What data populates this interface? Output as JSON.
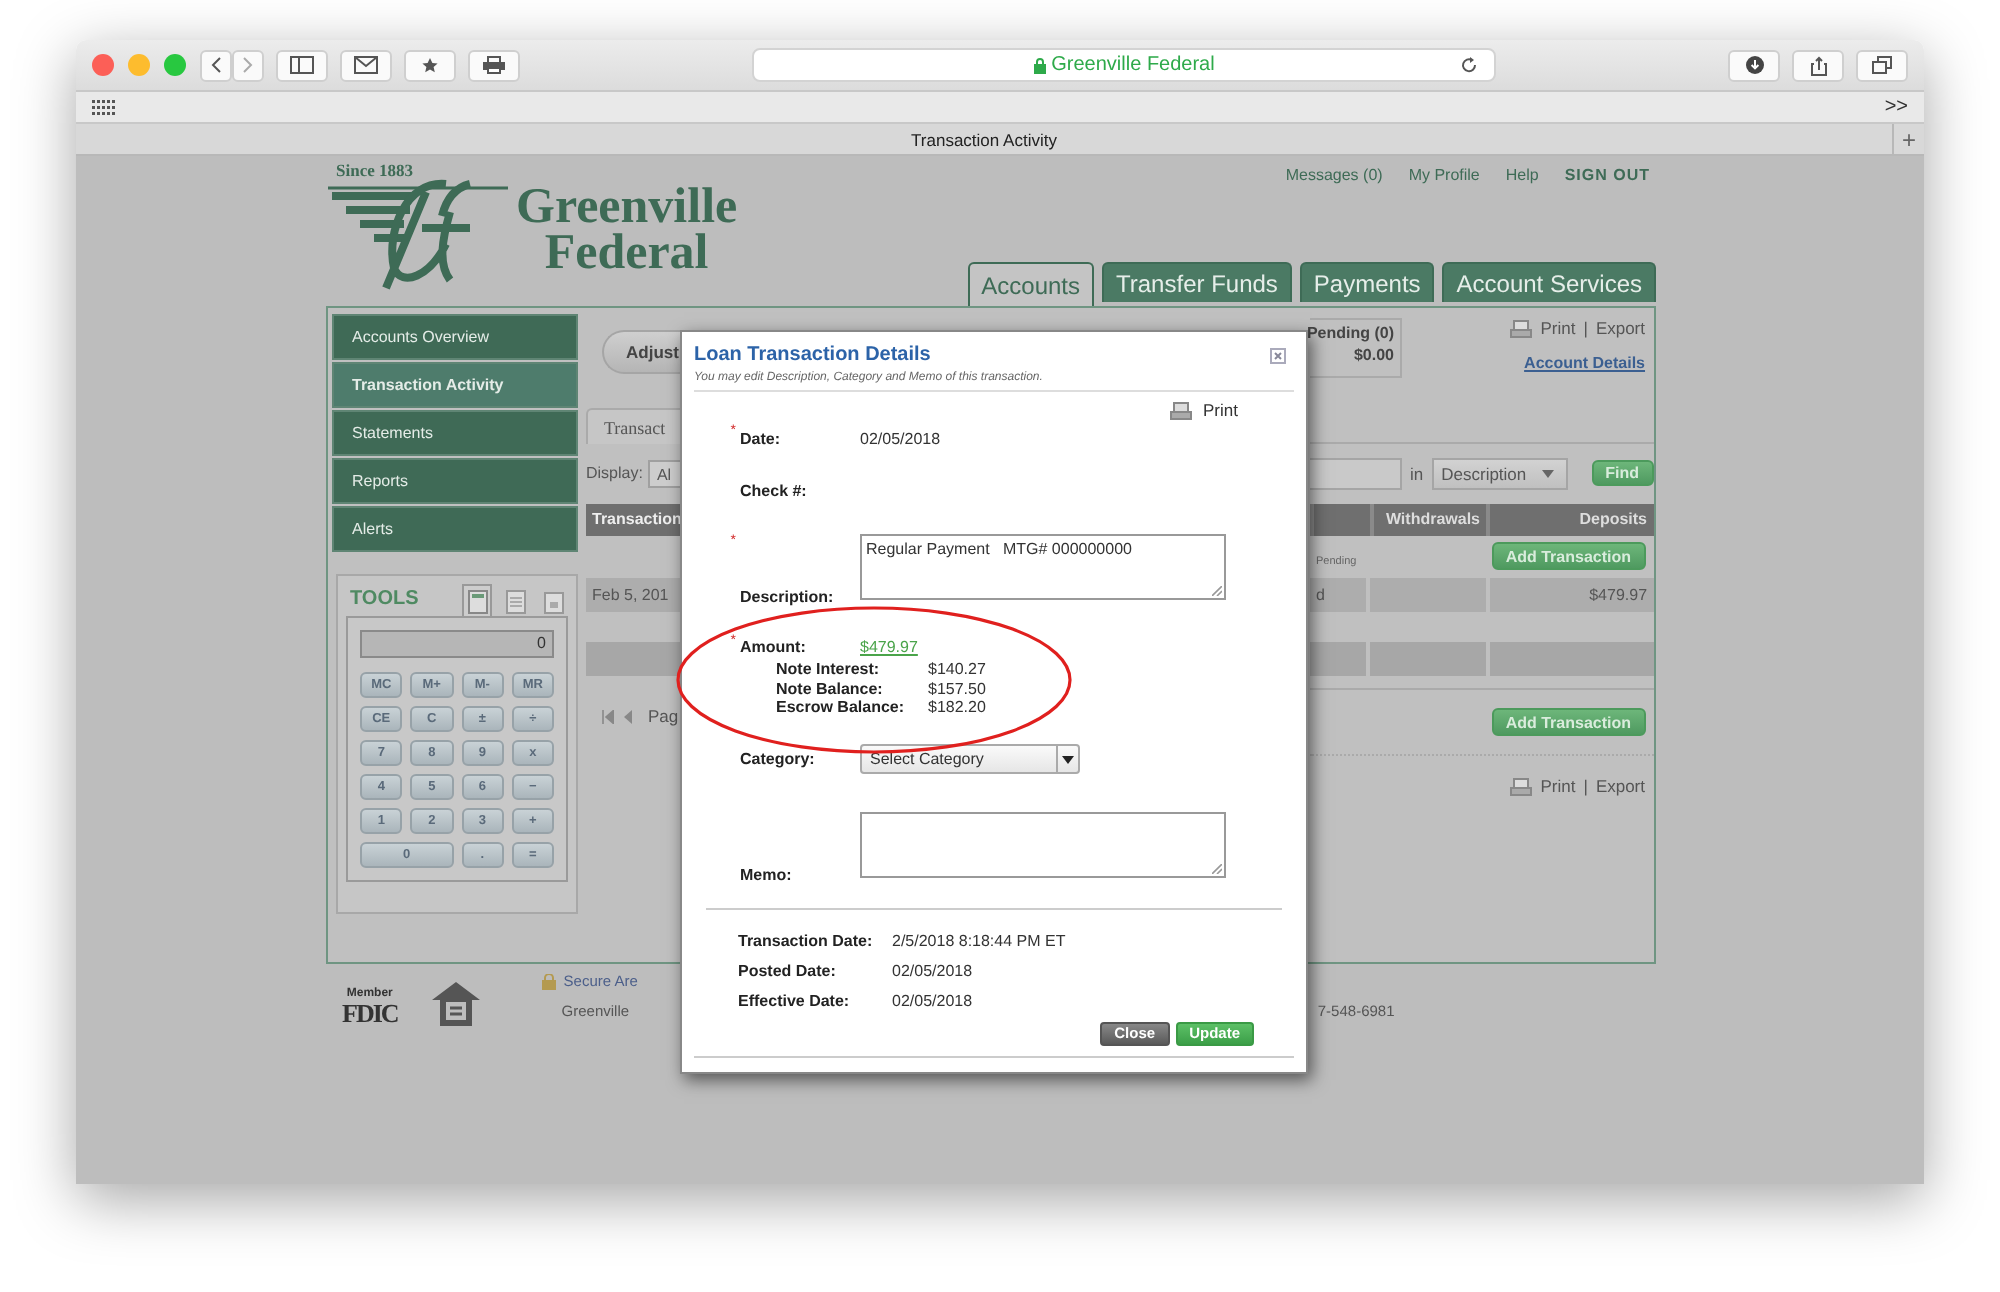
{
  "browser": {
    "address": "Greenville Federal",
    "more": ">>",
    "tab_title": "Transaction Activity",
    "new_tab": "+"
  },
  "header": {
    "logo": {
      "since": "Since 1883",
      "line1": "Greenville",
      "line2": "Federal"
    },
    "top_links": [
      {
        "label": "Messages (0)",
        "kind": "link"
      },
      {
        "label": "My Profile",
        "kind": "link"
      },
      {
        "label": "Help",
        "kind": "link"
      },
      {
        "label": "SIGN OUT",
        "kind": "strong"
      }
    ],
    "tabs": [
      {
        "label": "Accounts",
        "selected": true
      },
      {
        "label": "Transfer Funds",
        "selected": false
      },
      {
        "label": "Payments",
        "selected": false
      },
      {
        "label": "Account Services",
        "selected": false
      }
    ]
  },
  "sidebar": {
    "items": [
      {
        "label": "Accounts Overview",
        "selected": false
      },
      {
        "label": "Transaction Activity",
        "selected": true
      },
      {
        "label": "Statements",
        "selected": false
      },
      {
        "label": "Reports",
        "selected": false
      },
      {
        "label": "Alerts",
        "selected": false
      }
    ]
  },
  "tools": {
    "title": "TOOLS",
    "tabs": [
      {
        "kind": "calculator",
        "selected": true
      },
      {
        "kind": "notes",
        "selected": false
      },
      {
        "kind": "calendar",
        "selected": false
      }
    ],
    "display": "0",
    "keys": [
      [
        "MC",
        "M+",
        "M-",
        "MR"
      ],
      [
        "CE",
        "C",
        "±",
        "÷"
      ],
      [
        "7",
        "8",
        "9",
        "x"
      ],
      [
        "4",
        "5",
        "6",
        "−"
      ],
      [
        "1",
        "2",
        "3",
        "+"
      ],
      [
        "0",
        ".",
        "="
      ]
    ]
  },
  "content_left": {
    "button": "Adjust",
    "tab": "Transact",
    "display_label": "Display:",
    "display_value": "Al",
    "column_1": "Transaction",
    "row_date": "Feb 5, 201",
    "pager": "Pag"
  },
  "content_right": {
    "pending_label": "Pending (0)",
    "pending_amount": "$0.00",
    "print": "Print",
    "separator": "|",
    "export": "Export",
    "account_details": "Account Details",
    "search_in": "in",
    "search_field": "Description",
    "find": "Find",
    "columns": [
      "Withdrawals",
      "Deposits"
    ],
    "pending_note": "Pending",
    "add_transaction": "Add Transaction",
    "row": [
      "d",
      "$479.97"
    ],
    "add_transaction_bottom": "Add Transaction",
    "print_bottom": "Print",
    "separator_bottom": "|",
    "export_bottom": "Export"
  },
  "footer": {
    "member": "Member",
    "fdic": "FDIC",
    "secure": "Secure Are",
    "bank": "Greenville",
    "phone": "7-548-6981"
  },
  "modal": {
    "title": "Loan Transaction Details",
    "subtitle": "You may edit Description, Category and Memo of this transaction.",
    "print": "Print",
    "required_mark": "*",
    "fields": [
      {
        "kind": "text",
        "label": "Date:",
        "required": true,
        "value": "02/05/2018"
      },
      {
        "kind": "text",
        "label": "Check #:",
        "required": false
      },
      {
        "kind": "textarea",
        "label": "Description:",
        "required": true,
        "value": "Regular Payment   MTG# 000000000"
      },
      {
        "kind": "amount",
        "label": "Amount:",
        "required": true,
        "value": "$479.97",
        "breakdown": [
          {
            "label": "Note Interest:",
            "value": "$140.27"
          },
          {
            "label": "Note Balance:",
            "value": "$157.50"
          },
          {
            "label": "Escrow Balance:",
            "value": "$182.20"
          }
        ]
      },
      {
        "kind": "select",
        "label": "Category:",
        "required": false,
        "value": "Select Category"
      },
      {
        "kind": "textarea",
        "label": "Memo:",
        "required": false
      }
    ],
    "info": [
      {
        "label": "Transaction Date:",
        "value": "2/5/2018 8:18:44 PM ET"
      },
      {
        "label": "Posted Date:",
        "value": "02/05/2018"
      },
      {
        "label": "Effective Date:",
        "value": "02/05/2018"
      }
    ],
    "buttons": [
      {
        "label": "Close",
        "kind": "secondary"
      },
      {
        "label": "Update",
        "kind": "primary"
      }
    ]
  }
}
